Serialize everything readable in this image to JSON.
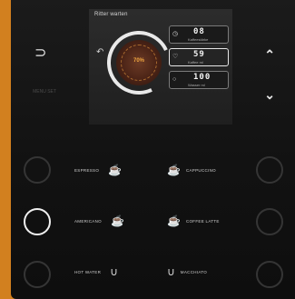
{
  "screen": {
    "title": "Ritter warten",
    "dial_label": "70%",
    "params": [
      {
        "icon": "clock-icon",
        "value": "08",
        "label": "Kaffeestärke"
      },
      {
        "icon": "heart-icon",
        "value": "59",
        "label": "Kaffee ml"
      },
      {
        "icon": "drop-icon",
        "value": "100",
        "label": "Wasser ml"
      }
    ]
  },
  "side": {
    "back_icon": "back-arrow-icon",
    "faded_label": "MENU SET"
  },
  "nav": {
    "up_icon": "chevron-up-icon",
    "down_icon": "chevron-down-icon"
  },
  "drinks": {
    "espresso": "ESPRESSO",
    "cappuccino": "CAPPUCCINO",
    "americano": "AMERICANO",
    "coffee_latte": "COFFEE LATTE",
    "hot_water": "HOT WATER",
    "macchiato": "MACCHIATO"
  },
  "colors": {
    "frame": "#d2801f",
    "panel": "#151515",
    "accent": "#f0a640"
  }
}
